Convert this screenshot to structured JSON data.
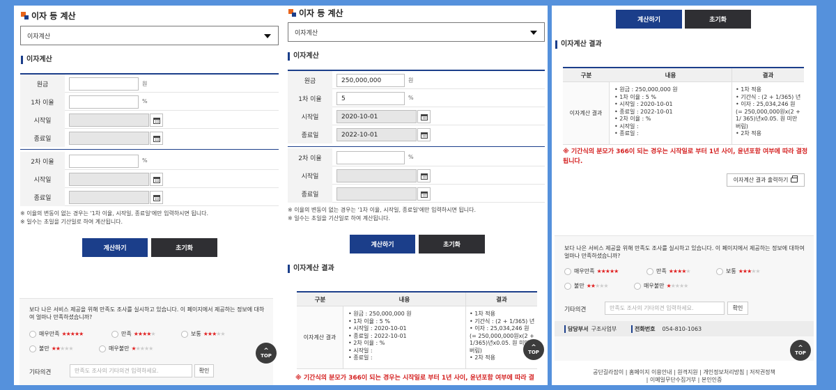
{
  "app": {
    "title": "이자 등 계산",
    "select_value": "이자계산"
  },
  "calc": {
    "section_title": "이자계산",
    "labels": {
      "principal": "원금",
      "rate1": "1차 이율",
      "start": "시작일",
      "end": "종료일",
      "rate2": "2차 이율"
    },
    "units": {
      "won": "원",
      "pct": "%"
    },
    "notes": [
      "※ 이율의 변동이 없는 경우는 '1차 이율, 시작일, 종료일'에만 입력하시면 됩니다.",
      "※ 일수는 초일을 기산일로 하여 계산됩니다."
    ],
    "calc_button": "계산하기",
    "reset_button": "초기화"
  },
  "filled": {
    "principal": "250,000,000",
    "rate1": "5",
    "start": "2020-10-01",
    "end": "2022-10-01"
  },
  "result": {
    "section_title": "이자계산 결과",
    "headers": [
      "구분",
      "내용",
      "결과"
    ],
    "row_label": "이자계산 결과",
    "content": [
      "원금 : 250,000,000 원",
      "1차 이율 : 5 %",
      "시작일 : 2020-10-01",
      "종료일 : 2022-10-01",
      "2차 이율 : %",
      "시작일 :",
      "종료일 :"
    ],
    "result_p2": [
      "1차 적용",
      "기간식 : (2 + 1/365) 년",
      "이자 : 25,034,246 원 (= 250,000,000원x(2 + 1/365)년x0.05. 원 미만 버림)",
      "2차 적용"
    ],
    "result_p3": [
      "1차 적용",
      "기간식 : (2 + 1/365) 년",
      "이자 : 25,034,246 원 (= 250,000,000원x(2 + 1/ 365)년x0.05. 원 미만 버림)",
      "2차 적용"
    ],
    "warning": "※ 기간식의 분모가 366이 되는 경우는 시작일로 부터 1년 사이, 윤년포함 여부에 따라 결정됩니다.",
    "warning_p2": "※ 기간식의 분모가 366이 되는 경우는 시작일로 부터 1년 사이, 윤년포함 여부에 따라 결",
    "print_button": "이자계산 결과 출력하기"
  },
  "survey": {
    "question": "보다 나은 서비스 제공을 위해 만족도 조사를 실시하고 있습니다. 이 페이지에서 제공하는 정보에 대하여 얼마나 만족하셨습니까?",
    "options": [
      {
        "label": "매우만족",
        "stars": 5
      },
      {
        "label": "만족",
        "stars": 4
      },
      {
        "label": "보통",
        "stars": 3
      },
      {
        "label": "불만",
        "stars": 2
      },
      {
        "label": "매우불만",
        "stars": 1
      }
    ],
    "etc_label": "기타의견",
    "etc_placeholder": "만족도 조사의 기타의견 입력하세요.",
    "add_button": "확인"
  },
  "dept": {
    "dept_label": "담당부서",
    "dept_value": "구조사업부",
    "phone_label": "전화번호",
    "phone_value": "054-810-1063"
  },
  "footer": {
    "line1": "공단길라잡이 | 홈페이지 이용안내 | 원격지원 | 개인정보처리방침 | 저작권정책",
    "line2": "| 이메일무단수집거부 | 본인인증"
  },
  "top_label": "TOP",
  "colors": {
    "background": "#5591dc",
    "primary": "#1b3e8a",
    "dark": "#2f2f33",
    "star": "#e02020",
    "warning": "#d42020"
  }
}
